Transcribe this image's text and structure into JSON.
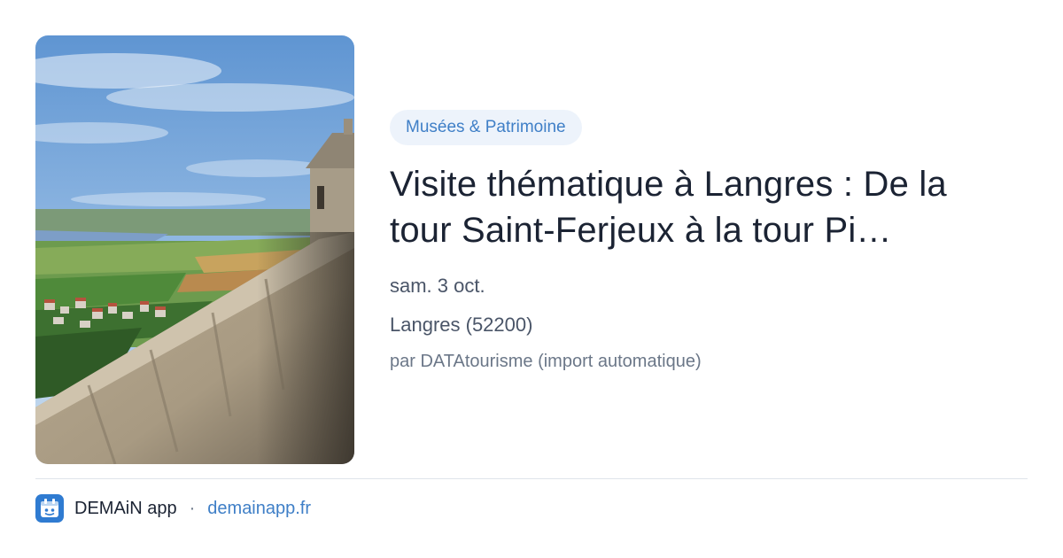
{
  "event": {
    "category": "Musées & Patrimoine",
    "title_line1": "Visite thématique à Langres : De la",
    "title_line2": "tour Saint-Ferjeux à la tour Pi…",
    "date": "sam. 3 oct.",
    "location": "Langres (52200)",
    "source": "par DATAtourisme (import automatique)",
    "image_icon": "landscape-photo"
  },
  "footer": {
    "app_name": "DEMAiN app",
    "separator": "·",
    "link_text": "demainapp.fr",
    "app_icon": "calendar-app-icon"
  },
  "colors": {
    "accent": "#3f7fc7",
    "tag_background": "#edf3fb",
    "title": "#1b2333",
    "meta": "#4a5568",
    "divider": "#dfe4ea"
  }
}
